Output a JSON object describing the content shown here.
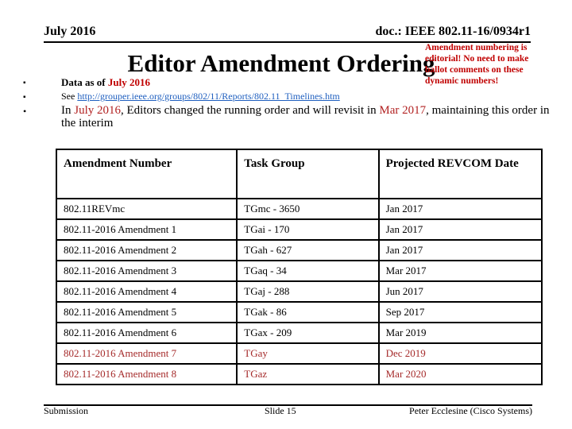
{
  "header": {
    "date": "July 2016",
    "doc_id": "doc.: IEEE 802.11-16/0934r1"
  },
  "note": "Amendment numbering is editorial! No need to make ballot comments on these dynamic numbers!",
  "title": "Editor Amendment Ordering",
  "bullets": {
    "data_as_of_prefix": "Data as of ",
    "data_as_of_date": "July 2016",
    "see_prefix": "See ",
    "see_link": "http://grouper.ieee.org/groups/802/11/Reports/802.11_Timelines.htm",
    "change_p1": "In ",
    "change_date1": "July 2016",
    "change_p2": ", Editors changed the running order and will revisit in ",
    "change_date2": "Mar 2017",
    "change_p3": ", maintaining this order in the interim"
  },
  "table": {
    "headers": [
      "Amendment Number",
      "Task Group",
      "Projected REVCOM Date"
    ],
    "rows": [
      {
        "amendment": "802.11REVmc",
        "task_group": "TGmc - 3650",
        "revcom_date": "Jan 2017"
      },
      {
        "amendment": "802.11-2016 Amendment 1",
        "task_group": "TGai - 170",
        "revcom_date": "Jan 2017"
      },
      {
        "amendment": "802.11-2016 Amendment 2",
        "task_group": "TGah - 627",
        "revcom_date": "Jan 2017"
      },
      {
        "amendment": "802.11-2016 Amendment 3",
        "task_group": "TGaq - 34",
        "revcom_date": "Mar 2017"
      },
      {
        "amendment": "802.11-2016 Amendment 4",
        "task_group": "TGaj - 288",
        "revcom_date": "Jun 2017"
      },
      {
        "amendment": "802.11-2016 Amendment 5",
        "task_group": "TGak - 86",
        "revcom_date": "Sep 2017"
      },
      {
        "amendment": "802.11-2016 Amendment 6",
        "task_group": "TGax - 209",
        "revcom_date": "Mar 2019"
      },
      {
        "amendment": "802.11-2016 Amendment 7",
        "task_group": "TGay",
        "revcom_date": "Dec 2019"
      },
      {
        "amendment": "802.11-2016 Amendment 8",
        "task_group": "TGaz",
        "revcom_date": "Mar 2020"
      }
    ]
  },
  "colors": {
    "accent_red": "#c00000",
    "pending_row": "#a52a2a",
    "link": "#1f5fbf"
  },
  "footer": {
    "left": "Submission",
    "center": "Slide 15",
    "right": "Peter Ecclesine (Cisco Systems)"
  }
}
